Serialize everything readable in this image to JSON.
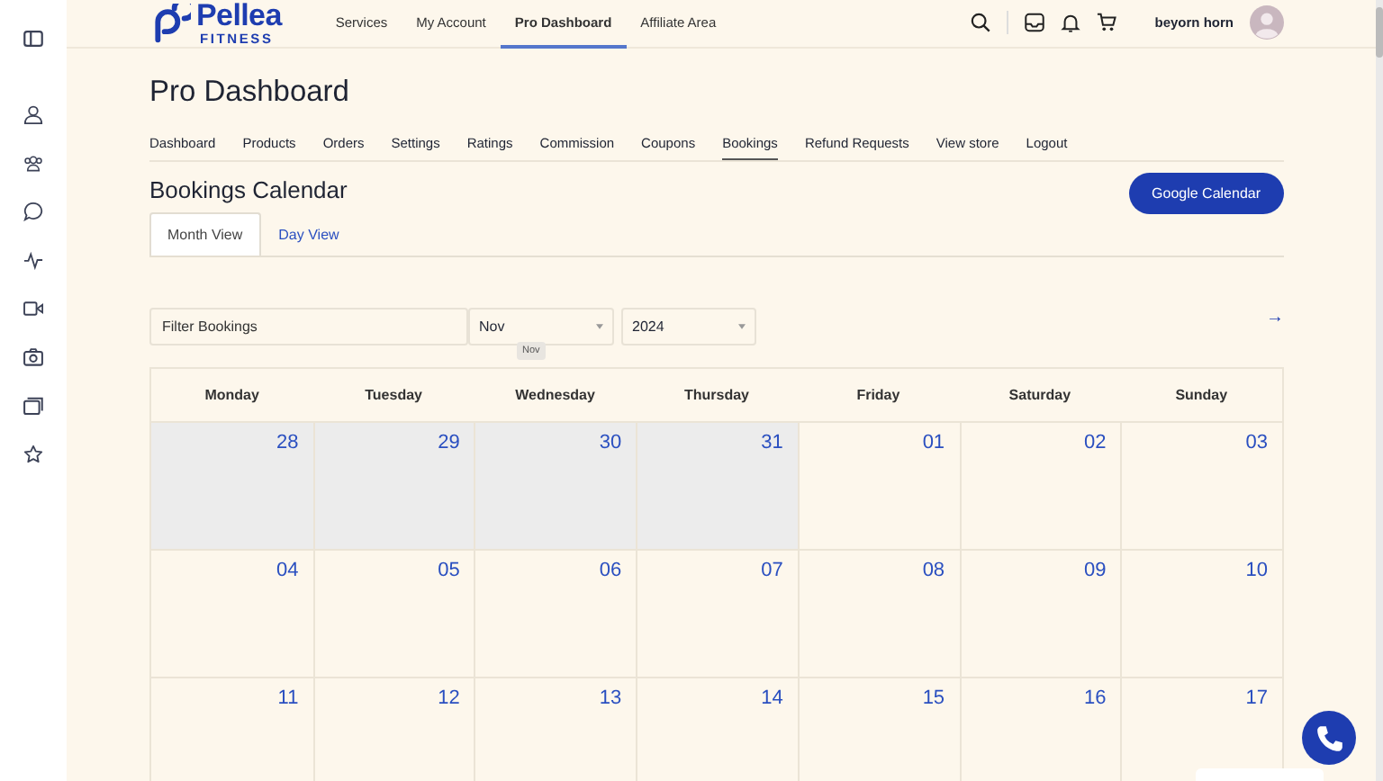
{
  "logo": {
    "name": "Pellea",
    "tagline": "FITNESS"
  },
  "nav": [
    {
      "label": "Services",
      "selected": false
    },
    {
      "label": "My Account",
      "selected": false
    },
    {
      "label": "Pro Dashboard",
      "selected": true
    },
    {
      "label": "Affiliate Area",
      "selected": false
    }
  ],
  "user": {
    "name": "beyorn horn"
  },
  "page_title": "Pro Dashboard",
  "dashboard_tabs": [
    {
      "label": "Dashboard",
      "selected": false
    },
    {
      "label": "Products",
      "selected": false
    },
    {
      "label": "Orders",
      "selected": false
    },
    {
      "label": "Settings",
      "selected": false
    },
    {
      "label": "Ratings",
      "selected": false
    },
    {
      "label": "Commission",
      "selected": false
    },
    {
      "label": "Coupons",
      "selected": false
    },
    {
      "label": "Bookings",
      "selected": true
    },
    {
      "label": "Refund Requests",
      "selected": false
    },
    {
      "label": "View store",
      "selected": false
    },
    {
      "label": "Logout",
      "selected": false
    }
  ],
  "section_title": "Bookings Calendar",
  "google_button": "Google Calendar",
  "view_tabs": [
    {
      "label": "Month View",
      "selected": true
    },
    {
      "label": "Day View",
      "selected": false
    }
  ],
  "filter": {
    "placeholder": "Filter Bookings",
    "month": "Nov",
    "year": "2024",
    "tooltip": "Nov"
  },
  "next_arrow": "→",
  "calendar": {
    "weekdays": [
      "Monday",
      "Tuesday",
      "Wednesday",
      "Thursday",
      "Friday",
      "Saturday",
      "Sunday"
    ],
    "weeks": [
      [
        {
          "day": "28",
          "muted": true
        },
        {
          "day": "29",
          "muted": true
        },
        {
          "day": "30",
          "muted": true
        },
        {
          "day": "31",
          "muted": true
        },
        {
          "day": "01",
          "muted": false
        },
        {
          "day": "02",
          "muted": false
        },
        {
          "day": "03",
          "muted": false
        }
      ],
      [
        {
          "day": "04",
          "muted": false
        },
        {
          "day": "05",
          "muted": false
        },
        {
          "day": "06",
          "muted": false
        },
        {
          "day": "07",
          "muted": false
        },
        {
          "day": "08",
          "muted": false
        },
        {
          "day": "09",
          "muted": false
        },
        {
          "day": "10",
          "muted": false
        }
      ],
      [
        {
          "day": "11",
          "muted": false
        },
        {
          "day": "12",
          "muted": false
        },
        {
          "day": "13",
          "muted": false
        },
        {
          "day": "14",
          "muted": false
        },
        {
          "day": "15",
          "muted": false
        },
        {
          "day": "16",
          "muted": false
        },
        {
          "day": "17",
          "muted": false
        }
      ]
    ]
  }
}
